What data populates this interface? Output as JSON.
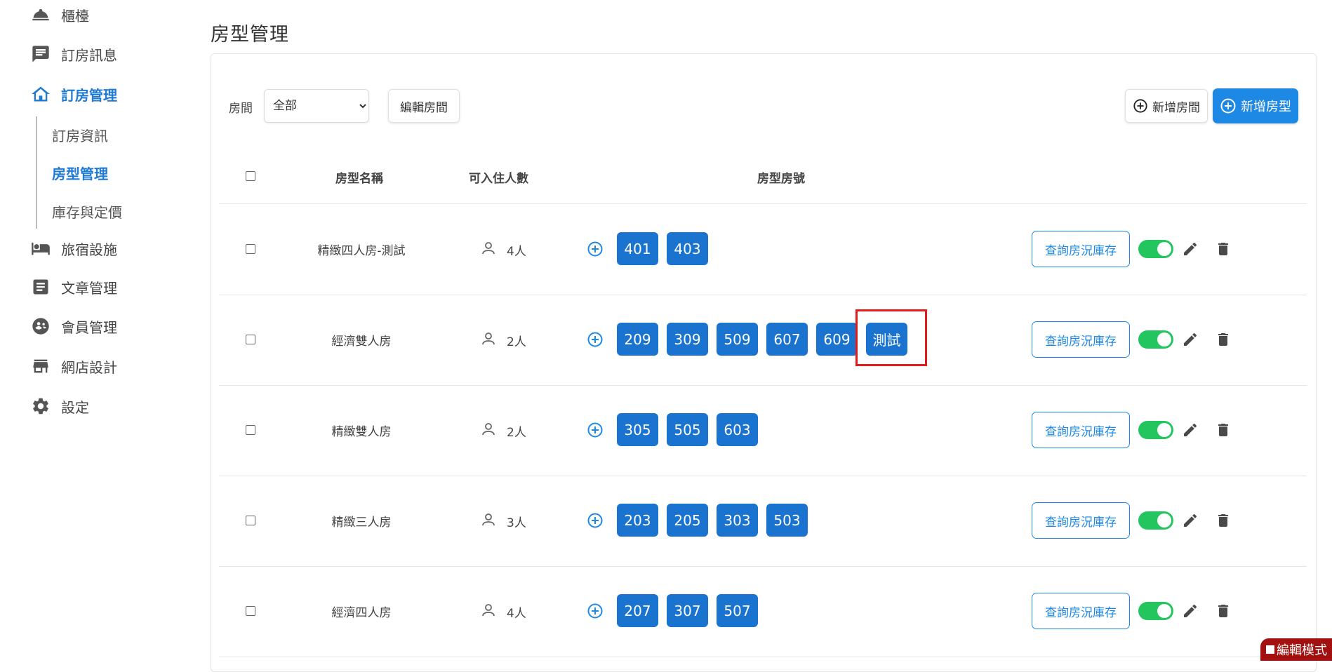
{
  "sidebar": {
    "items": [
      {
        "label": "櫃檯",
        "icon": "bell-icon"
      },
      {
        "label": "訂房訊息",
        "icon": "message-icon"
      },
      {
        "label": "訂房管理",
        "icon": "home-icon"
      },
      {
        "label": "旅宿設施",
        "icon": "bed-icon"
      },
      {
        "label": "文章管理",
        "icon": "article-icon"
      },
      {
        "label": "會員管理",
        "icon": "member-icon"
      },
      {
        "label": "網店設計",
        "icon": "store-icon"
      },
      {
        "label": "設定",
        "icon": "gear-icon"
      }
    ],
    "active_item": "訂房管理",
    "sub_items": [
      {
        "label": "訂房資訊"
      },
      {
        "label": "房型管理"
      },
      {
        "label": "庫存與定價"
      }
    ],
    "active_sub_item": "房型管理"
  },
  "page": {
    "title": "房型管理"
  },
  "toolbar": {
    "filter_label": "房間",
    "filter_value": "全部",
    "edit_rooms_label": "編輯房間",
    "add_room_label": "新增房間",
    "add_room_type_label": "新增房型"
  },
  "table": {
    "headers": {
      "name": "房型名稱",
      "occupancy": "可入住人數",
      "rooms": "房型房號"
    },
    "rows": [
      {
        "name": "精緻四人房-測試",
        "occupancy": "4人",
        "rooms": [
          "401",
          "403"
        ],
        "query_label": "查詢房況庫存",
        "enabled": true
      },
      {
        "name": "經濟雙人房",
        "occupancy": "2人",
        "rooms": [
          "209",
          "309",
          "509",
          "607",
          "609",
          "測試"
        ],
        "query_label": "查詢房況庫存",
        "enabled": true
      },
      {
        "name": "精緻雙人房",
        "occupancy": "2人",
        "rooms": [
          "305",
          "505",
          "603"
        ],
        "query_label": "查詢房況庫存",
        "enabled": true
      },
      {
        "name": "精緻三人房",
        "occupancy": "3人",
        "rooms": [
          "203",
          "205",
          "303",
          "503"
        ],
        "query_label": "查詢房況庫存",
        "enabled": true
      },
      {
        "name": "經濟四人房",
        "occupancy": "4人",
        "rooms": [
          "207",
          "307",
          "507"
        ],
        "query_label": "查詢房況庫存",
        "enabled": true
      }
    ]
  },
  "badge": {
    "edit_mode_label": "編輯模式"
  },
  "colors": {
    "primary": "#1e88e5",
    "chip": "#1a73cf",
    "toggle_on": "#22c55e",
    "highlight": "#e21b1b",
    "badge": "#a31010"
  }
}
